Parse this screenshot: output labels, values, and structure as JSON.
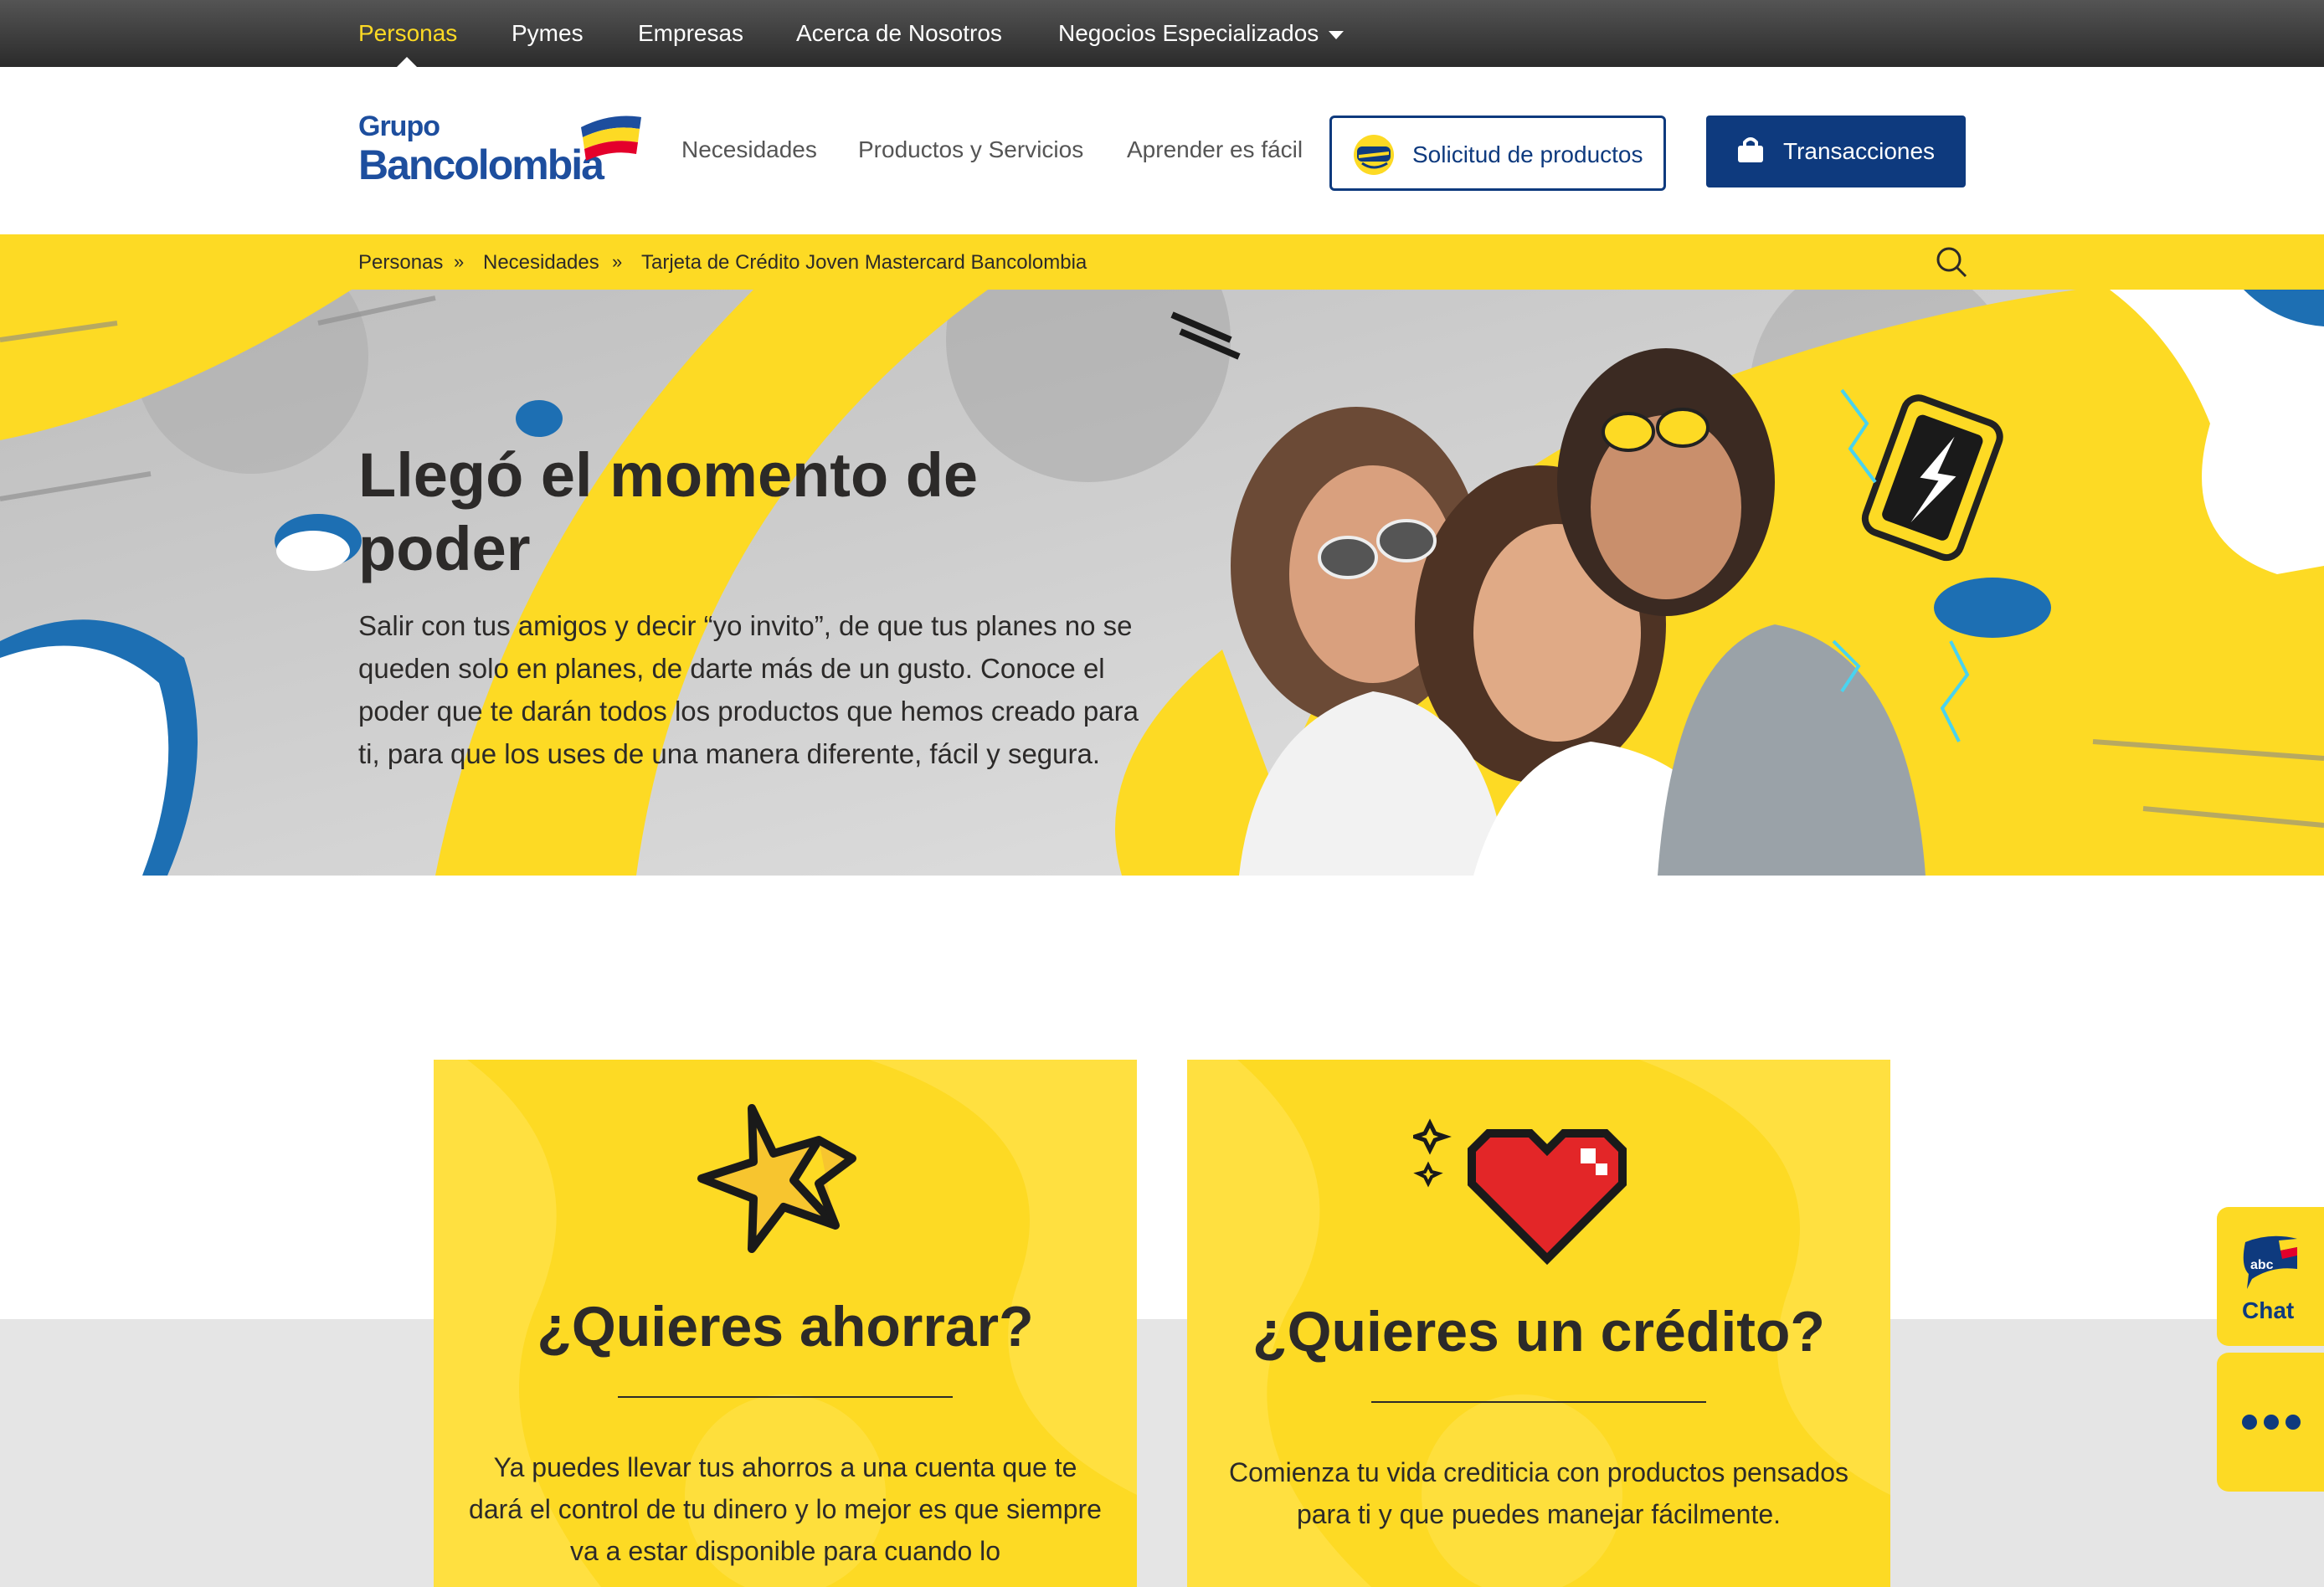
{
  "top_nav": {
    "items": [
      "Personas",
      "Pymes",
      "Empresas",
      "Acerca de Nosotros",
      "Negocios Especializados"
    ],
    "active": "Personas"
  },
  "header": {
    "logo_line1": "Grupo",
    "logo_line2": "Bancolombia",
    "nav": [
      "Necesidades",
      "Productos y Servicios",
      "Aprender es fácil"
    ],
    "solicitud_button": "Solicitud de productos",
    "transacciones_button": "Transacciones"
  },
  "breadcrumb": [
    "Personas",
    "Necesidades",
    "Tarjeta de Crédito Joven Mastercard Bancolombia"
  ],
  "breadcrumb_separator": "»",
  "hero": {
    "title": "Llegó el momento de poder",
    "body": "Salir con tus amigos y decir “yo invito”, de que tus planes no se queden solo en planes, de darte más de un gusto. Conoce el poder que te darán todos los productos que hemos creado para ti, para que los uses de una manera diferente, fácil y segura."
  },
  "cards": [
    {
      "title": "¿Quieres ahorrar?",
      "icon": "star-icon",
      "text": "Ya puedes llevar tus ahorros a una cuenta que te dará el control de tu dinero y lo mejor es que siempre va a estar disponible para cuando lo"
    },
    {
      "title": "¿Quieres un crédito?",
      "icon": "pixel-heart-icon",
      "text": "Comienza tu vida crediticia con productos pensados para ti y que puedes manejar fácilmente."
    }
  ],
  "chat_widget": {
    "badge": "abc",
    "label": "Chat"
  },
  "colors": {
    "brand_yellow": "#fdda24",
    "brand_blue": "#0e3a7e",
    "text_dark": "#2c2a29"
  }
}
